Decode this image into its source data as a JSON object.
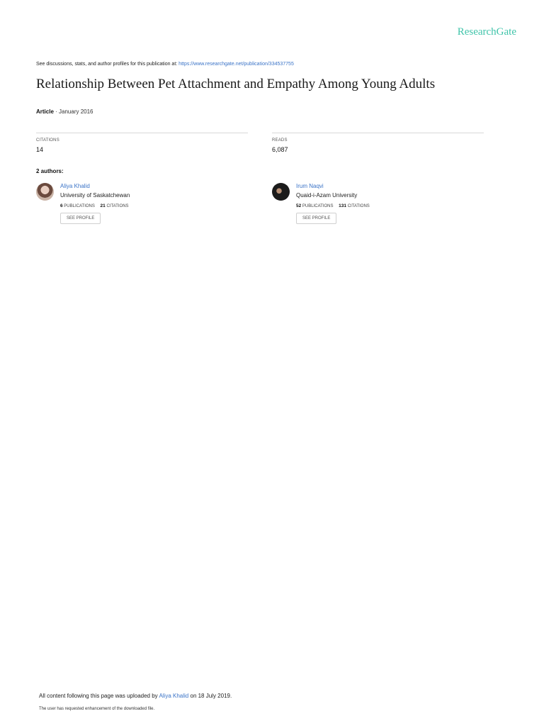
{
  "brand": {
    "logo_text": "ResearchGate",
    "accent_color": "#40c4aa",
    "link_color": "#3a73c7"
  },
  "header": {
    "discuss_text": "See discussions, stats, and author profiles for this publication at: ",
    "publication_url": "https://www.researchgate.net/publication/334537755"
  },
  "article": {
    "title": "Relationship Between Pet Attachment and Empathy Among Young Adults",
    "type": "Article",
    "separator": " · ",
    "date": "January 2016"
  },
  "stats": {
    "citations_label": "CITATIONS",
    "citations_value": "14",
    "reads_label": "READS",
    "reads_value": "6,087"
  },
  "authors_heading": "2 authors:",
  "authors": [
    {
      "name": "Aliya Khalid",
      "institution": "University of Saskatchewan",
      "publications": "6",
      "publications_label": "PUBLICATIONS",
      "citations": "21",
      "citations_label": "CITATIONS",
      "button": "SEE PROFILE"
    },
    {
      "name": "Irum Naqvi",
      "institution": "Quaid-i-Azam University",
      "publications": "52",
      "publications_label": "PUBLICATIONS",
      "citations": "131",
      "citations_label": "CITATIONS",
      "button": "SEE PROFILE"
    }
  ],
  "footer": {
    "uploaded_prefix": "All content following this page was uploaded by ",
    "uploader": "Aliya Khalid",
    "uploaded_suffix": " on 18 July 2019.",
    "note": "The user has requested enhancement of the downloaded file."
  }
}
